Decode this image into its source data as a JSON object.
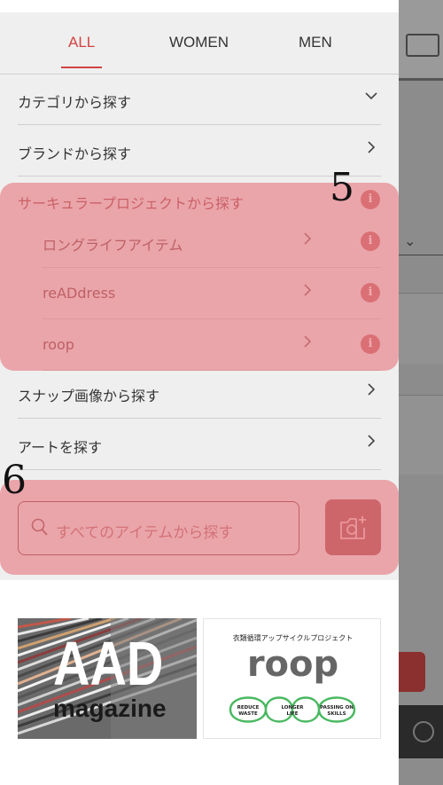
{
  "tabs": [
    {
      "label": "ALL",
      "active": true
    },
    {
      "label": "WOMEN",
      "active": false
    },
    {
      "label": "MEN",
      "active": false
    }
  ],
  "menu": {
    "category": "カテゴリから探す",
    "brand": "ブランドから探す",
    "circular": {
      "label": "サーキュラープロジェクトから探す",
      "items": [
        "ロングライフアイテム",
        "reADdress",
        "roop"
      ]
    },
    "snap": "スナップ画像から探す",
    "art": "アートを探す"
  },
  "search": {
    "placeholder": "すべてのアイテムから探す"
  },
  "annotations": {
    "five": "5",
    "six": "6"
  },
  "info_glyph": "i",
  "banners": {
    "aad": {
      "line1": "AAD",
      "line2": "magazine"
    },
    "roop": {
      "header": "衣類循環アップサイクルプロジェクト",
      "logo": "roop",
      "left": "REDUCE WASTE",
      "middle": "LONGER LIFE",
      "right": "PASSING ON SKILLS"
    }
  },
  "colors": {
    "accent": "#d14343",
    "highlight": "#e67880",
    "camera": "#a44a4a"
  }
}
